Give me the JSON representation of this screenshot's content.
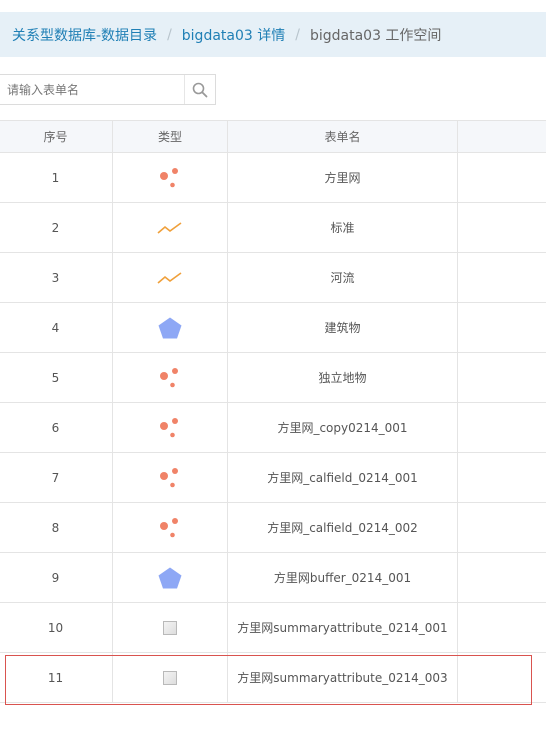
{
  "breadcrumb": {
    "items": [
      "关系型数据库-数据目录",
      "bigdata03 详情"
    ],
    "current": "bigdata03 工作空间",
    "separator": "/"
  },
  "search": {
    "placeholder": "请输入表单名"
  },
  "table": {
    "headers": [
      "序号",
      "类型",
      "表单名",
      ""
    ],
    "rows": [
      {
        "index": "1",
        "type": "point",
        "name": "方里网"
      },
      {
        "index": "2",
        "type": "line",
        "name": "标准"
      },
      {
        "index": "3",
        "type": "line",
        "name": "河流"
      },
      {
        "index": "4",
        "type": "polygon",
        "name": "建筑物"
      },
      {
        "index": "5",
        "type": "point",
        "name": "独立地物"
      },
      {
        "index": "6",
        "type": "point",
        "name": "方里网_copy0214_001"
      },
      {
        "index": "7",
        "type": "point",
        "name": "方里网_calfield_0214_001"
      },
      {
        "index": "8",
        "type": "point",
        "name": "方里网_calfield_0214_002"
      },
      {
        "index": "9",
        "type": "polygon",
        "name": "方里网buffer_0214_001"
      },
      {
        "index": "10",
        "type": "image",
        "name": "方里网summaryattribute_0214_001"
      },
      {
        "index": "11",
        "type": "image",
        "name": "方里网summaryattribute_0214_003"
      }
    ]
  },
  "colors": {
    "accent": "#1f7fb5",
    "point": "#f08368",
    "line": "#f0a03a",
    "polygon": "#8ea8f5",
    "highlight": "#d9534f"
  }
}
